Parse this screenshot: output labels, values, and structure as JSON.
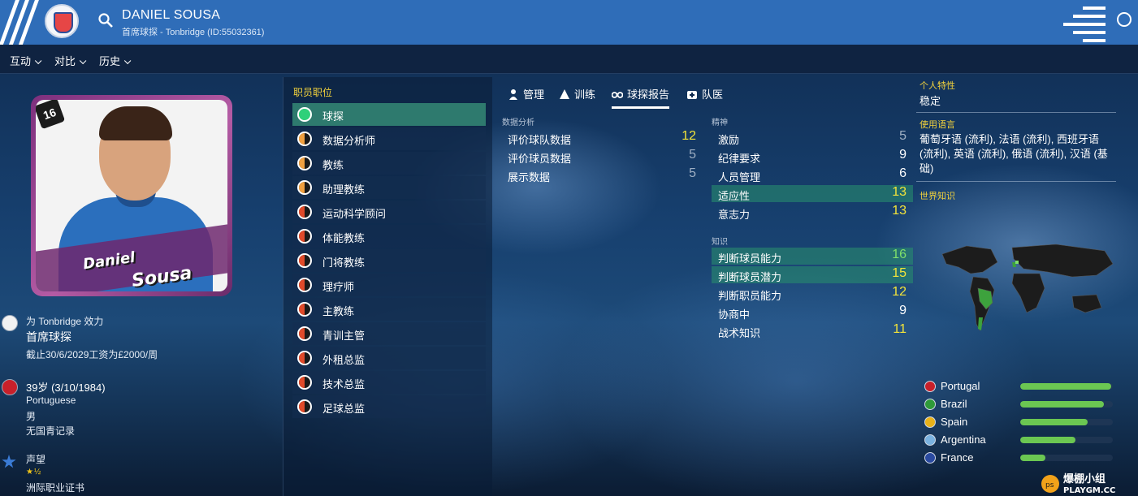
{
  "header": {
    "name": "DANIEL SOUSA",
    "subtitle": "首席球探 - Tonbridge (ID:55032361)"
  },
  "menu": [
    "互动",
    "对比",
    "历史"
  ],
  "portrait": {
    "name_line1": "Daniel",
    "name_line2": "Sousa",
    "rating": "16"
  },
  "profile": {
    "club_line": "为 Tonbridge 效力",
    "role": "首席球探",
    "contract": "截止30/6/2029工资为£2000/周",
    "age": "39岁 (3/10/1984)",
    "nationality": "Portuguese",
    "gender": "男",
    "youth_record": "无国青记录",
    "reputation_label": "声望",
    "reputation_stars": "★½",
    "license": "洲际职业证书"
  },
  "roles": {
    "title": "职员职位",
    "items": [
      {
        "label": "球探",
        "left": "#2fd07a",
        "right": "#2fd07a",
        "active": true
      },
      {
        "label": "数据分析师",
        "left": "#f0a040",
        "right": "#1a1a1a",
        "active": false
      },
      {
        "label": "教练",
        "left": "#f0a040",
        "right": "#1a1a1a",
        "active": false
      },
      {
        "label": "助理教练",
        "left": "#f0a040",
        "right": "#1a1a1a",
        "active": false
      },
      {
        "label": "运动科学顾问",
        "left": "#e04a2a",
        "right": "#1a1a1a",
        "active": false
      },
      {
        "label": "体能教练",
        "left": "#e04a2a",
        "right": "#1a1a1a",
        "active": false
      },
      {
        "label": "门将教练",
        "left": "#e04a2a",
        "right": "#1a1a1a",
        "active": false
      },
      {
        "label": "理疗师",
        "left": "#e04a2a",
        "right": "#1a1a1a",
        "active": false
      },
      {
        "label": "主教练",
        "left": "#e04a2a",
        "right": "#1a1a1a",
        "active": false
      },
      {
        "label": "青训主管",
        "left": "#e04a2a",
        "right": "#1a1a1a",
        "active": false
      },
      {
        "label": "外租总监",
        "left": "#e04a2a",
        "right": "#1a1a1a",
        "active": false
      },
      {
        "label": "技术总监",
        "left": "#e04a2a",
        "right": "#1a1a1a",
        "active": false
      },
      {
        "label": "足球总监",
        "left": "#e04a2a",
        "right": "#1a1a1a",
        "active": false
      }
    ]
  },
  "tabs": [
    {
      "label": "管理",
      "icon": "manager-icon",
      "active": false
    },
    {
      "label": "训练",
      "icon": "training-icon",
      "active": false
    },
    {
      "label": "球探报告",
      "icon": "binoculars-icon",
      "active": true
    },
    {
      "label": "队医",
      "icon": "medical-icon",
      "active": false
    }
  ],
  "attributes": {
    "data_analysis": {
      "title": "数据分析",
      "items": [
        {
          "label": "评价球队数据",
          "value": "12",
          "color": "yellow",
          "hl": false
        },
        {
          "label": "评价球员数据",
          "value": "5",
          "color": "gray",
          "hl": false
        },
        {
          "label": "展示数据",
          "value": "5",
          "color": "gray",
          "hl": false
        }
      ]
    },
    "mental": {
      "title": "精神",
      "items": [
        {
          "label": "激励",
          "value": "5",
          "color": "gray",
          "hl": false
        },
        {
          "label": "纪律要求",
          "value": "9",
          "color": "white",
          "hl": false
        },
        {
          "label": "人员管理",
          "value": "6",
          "color": "white",
          "hl": false
        },
        {
          "label": "适应性",
          "value": "13",
          "color": "yellow",
          "hl": true
        },
        {
          "label": "意志力",
          "value": "13",
          "color": "yellow",
          "hl": false
        }
      ]
    },
    "knowledge": {
      "title": "知识",
      "items": [
        {
          "label": "判断球员能力",
          "value": "16",
          "color": "green",
          "hl": true
        },
        {
          "label": "判断球员潜力",
          "value": "15",
          "color": "yellow",
          "hl": true
        },
        {
          "label": "判断职员能力",
          "value": "12",
          "color": "yellow",
          "hl": false
        },
        {
          "label": "协商中",
          "value": "9",
          "color": "white",
          "hl": false
        },
        {
          "label": "战术知识",
          "value": "11",
          "color": "yellow",
          "hl": false
        }
      ]
    }
  },
  "right": {
    "traits_title": "个人特性",
    "traits": "稳定",
    "languages_title": "使用语言",
    "languages": "葡萄牙语 (流利), 法语 (流利), 西班牙语 (流利), 英语 (流利), 俄语 (流利), 汉语 (基础)",
    "world_title": "世界知识",
    "nations": [
      {
        "name": "Portugal",
        "level": 0.98,
        "flag": "#c8202a"
      },
      {
        "name": "Brazil",
        "level": 0.9,
        "flag": "#2f9a3a"
      },
      {
        "name": "Spain",
        "level": 0.73,
        "flag": "#e8b21a"
      },
      {
        "name": "Argentina",
        "level": 0.6,
        "flag": "#7ab2e0"
      },
      {
        "name": "France",
        "level": 0.27,
        "flag": "#2a4aa0"
      }
    ]
  },
  "watermark": "爆棚小组 PLAYGM.CC"
}
